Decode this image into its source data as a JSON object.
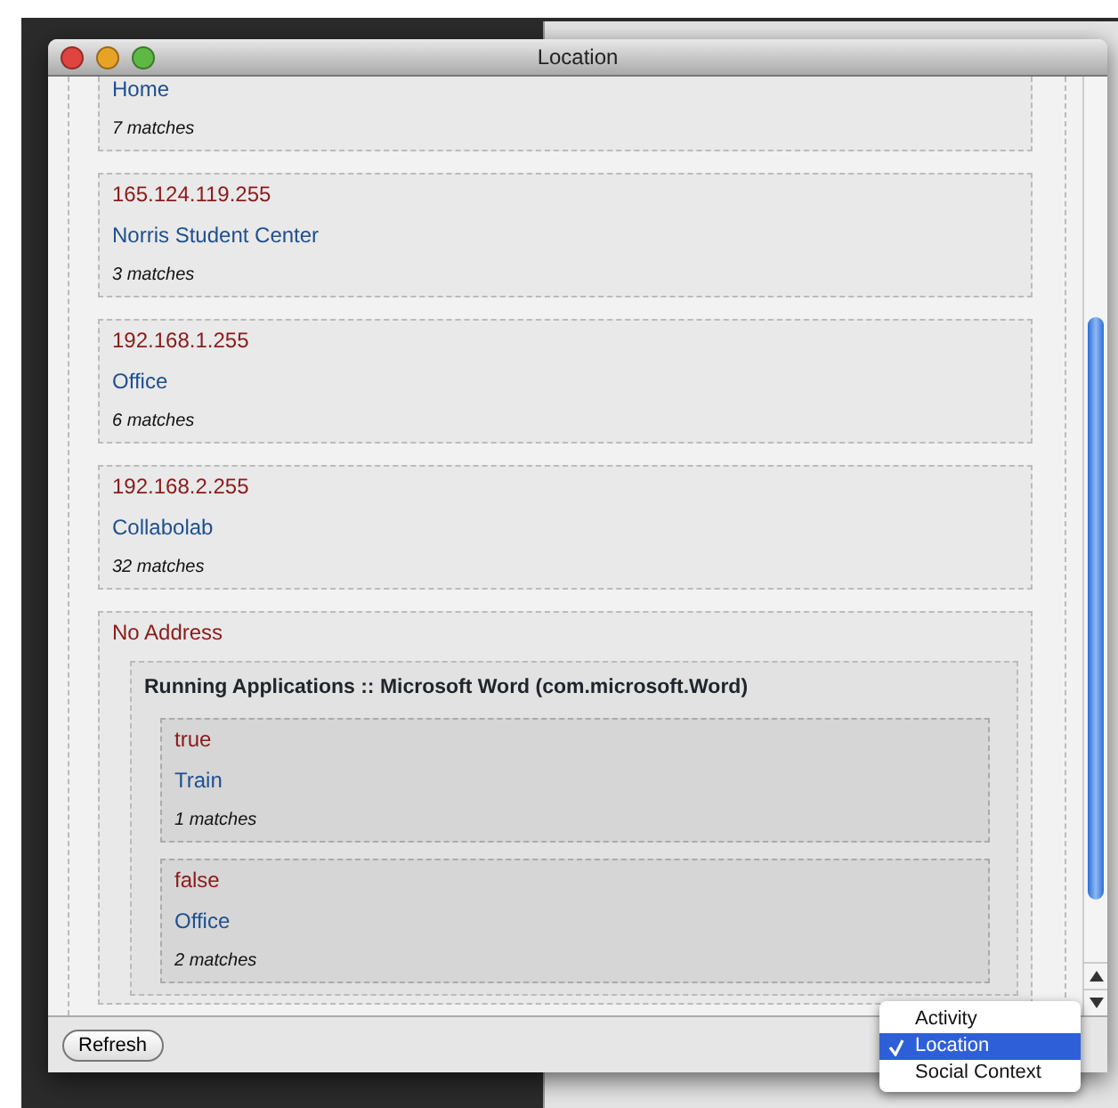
{
  "window": {
    "title": "Location"
  },
  "results": [
    {
      "label": "Home",
      "count": "7 matches"
    },
    {
      "address": "165.124.119.255",
      "label": "Norris Student Center",
      "count": "3 matches"
    },
    {
      "address": "192.168.1.255",
      "label": "Office",
      "count": "6 matches"
    },
    {
      "address": "192.168.2.255",
      "label": "Collabolab",
      "count": "32 matches"
    },
    {
      "address": "No Address",
      "groups": [
        {
          "title": "Running Applications :: Microsoft Word (com.microsoft.Word)",
          "entries": [
            {
              "value": "true",
              "label": "Train",
              "count": "1 matches"
            },
            {
              "value": "false",
              "label": "Office",
              "count": "2 matches"
            }
          ]
        }
      ]
    }
  ],
  "refresh_button": "Refresh",
  "view_menu": [
    {
      "label": "Activity",
      "selected": false
    },
    {
      "label": "Location",
      "selected": true
    },
    {
      "label": "Social Context",
      "selected": false
    }
  ]
}
